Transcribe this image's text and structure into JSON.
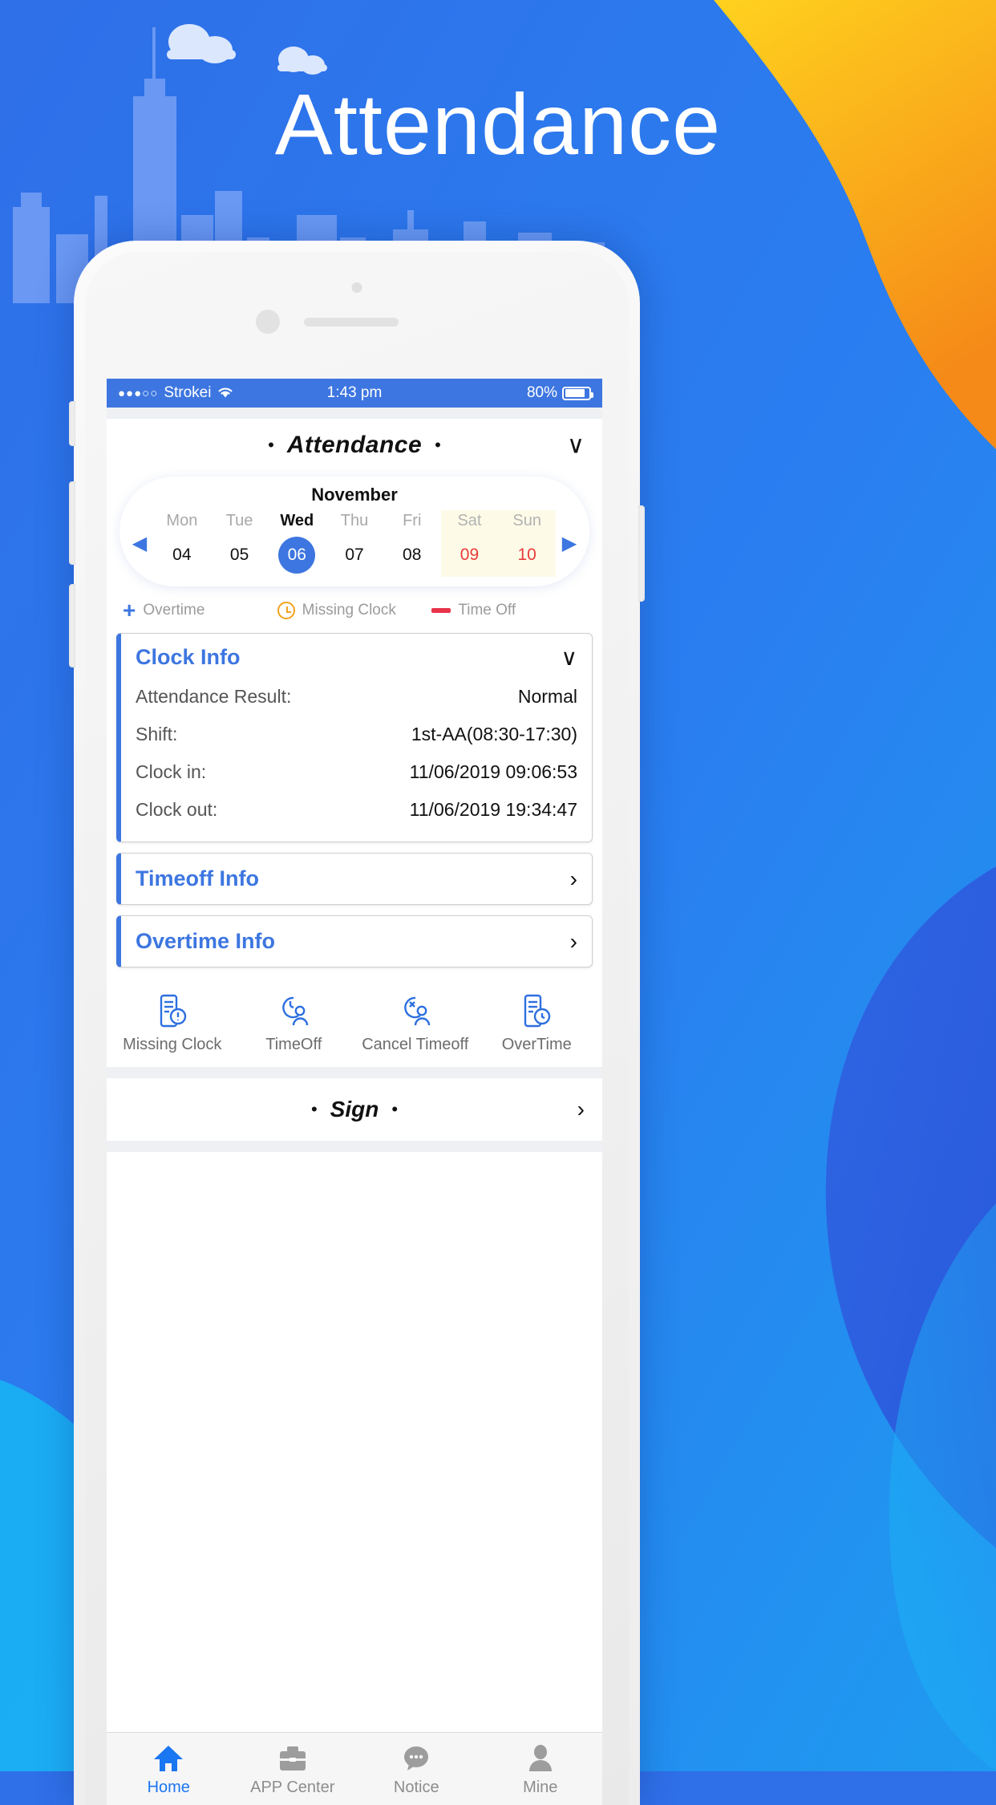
{
  "hero": {
    "title": "Attendance"
  },
  "colors": {
    "brand_blue": "#3d76e0",
    "nav_active": "#1b76f2",
    "weekend_red": "#e83b3b",
    "warn_orange": "#f0a31e",
    "danger_red": "#e8334a",
    "bg_gradient_from": "#2f6fe8",
    "bg_gradient_to": "#1e9bf0",
    "sun_from": "#ffd21e",
    "sun_to": "#f58a18"
  },
  "status_bar": {
    "signal_dots": "●●●○○",
    "carrier": "Strokei",
    "wifi_icon": "wifi-icon",
    "time": "1:43 pm",
    "battery_percent": "80%"
  },
  "app_header": {
    "left_dot": "•",
    "title": "Attendance",
    "right_dot": "•",
    "chevron": "∨"
  },
  "calendar": {
    "month": "November",
    "prev_arrow": "◀",
    "next_arrow": "▶",
    "days": [
      {
        "dow": "Mon",
        "num": "04",
        "today": false,
        "weekend": false
      },
      {
        "dow": "Tue",
        "num": "05",
        "today": false,
        "weekend": false
      },
      {
        "dow": "Wed",
        "num": "06",
        "today": true,
        "weekend": false
      },
      {
        "dow": "Thu",
        "num": "07",
        "today": false,
        "weekend": false
      },
      {
        "dow": "Fri",
        "num": "08",
        "today": false,
        "weekend": false
      },
      {
        "dow": "Sat",
        "num": "09",
        "today": false,
        "weekend": true
      },
      {
        "dow": "Sun",
        "num": "10",
        "today": false,
        "weekend": true
      }
    ]
  },
  "legend": [
    {
      "icon": "plus-icon",
      "label": "Overtime"
    },
    {
      "icon": "clock-icon",
      "label": "Missing Clock"
    },
    {
      "icon": "dash-icon",
      "label": "Time Off"
    }
  ],
  "clock_info": {
    "title": "Clock Info",
    "chevron": "∨",
    "rows": [
      {
        "key": "Attendance Result:",
        "value": "Normal"
      },
      {
        "key": "Shift:",
        "value": "1st-AA(08:30-17:30)"
      },
      {
        "key": "Clock in:",
        "value": "11/06/2019 09:06:53"
      },
      {
        "key": "Clock out:",
        "value": "11/06/2019 19:34:47"
      }
    ]
  },
  "timeoff_info": {
    "title": "Timeoff Info",
    "chevron": "›"
  },
  "overtime_info": {
    "title": "Overtime Info",
    "chevron": "›"
  },
  "quick_actions": [
    {
      "icon": "missing-clock-icon",
      "label": "Missing Clock"
    },
    {
      "icon": "timeoff-icon",
      "label": "TimeOff"
    },
    {
      "icon": "cancel-timeoff-icon",
      "label": "Cancel Timeoff"
    },
    {
      "icon": "overtime-icon",
      "label": "OverTime"
    }
  ],
  "sign_bar": {
    "left_dot": "•",
    "title": "Sign",
    "right_dot": "•",
    "chevron": "›"
  },
  "bottom_nav": [
    {
      "icon": "home-icon",
      "label": "Home",
      "active": true
    },
    {
      "icon": "briefcase-icon",
      "label": "APP Center",
      "active": false
    },
    {
      "icon": "chat-icon",
      "label": "Notice",
      "active": false
    },
    {
      "icon": "person-icon",
      "label": "Mine",
      "active": false
    }
  ]
}
